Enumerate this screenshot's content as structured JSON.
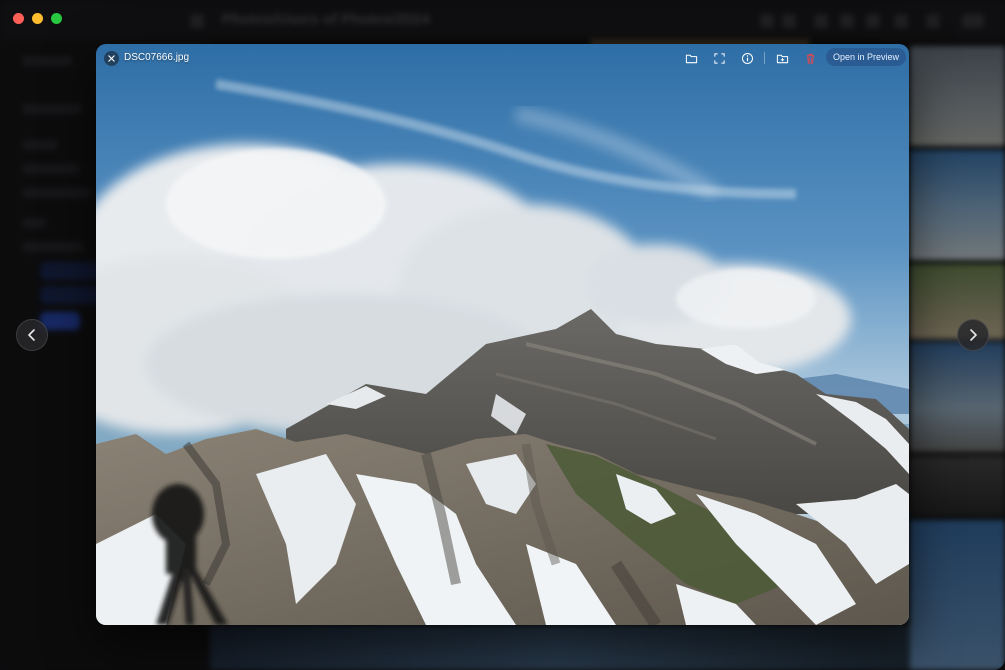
{
  "window": {
    "background_title": "Photos/Users of Photos/2024"
  },
  "preview": {
    "filename": "DSC07666.jpg",
    "open_button_label": "Open in Preview",
    "toolbar_icons": [
      "folder-icon",
      "fullscreen-icon",
      "info-icon",
      "move-to-folder-icon",
      "trash-icon"
    ]
  },
  "colors": {
    "accent": "#2c6fb5",
    "danger": "#e5484d",
    "traffic_red": "#fe5f57",
    "traffic_yellow": "#febc2e",
    "traffic_green": "#28c840"
  }
}
